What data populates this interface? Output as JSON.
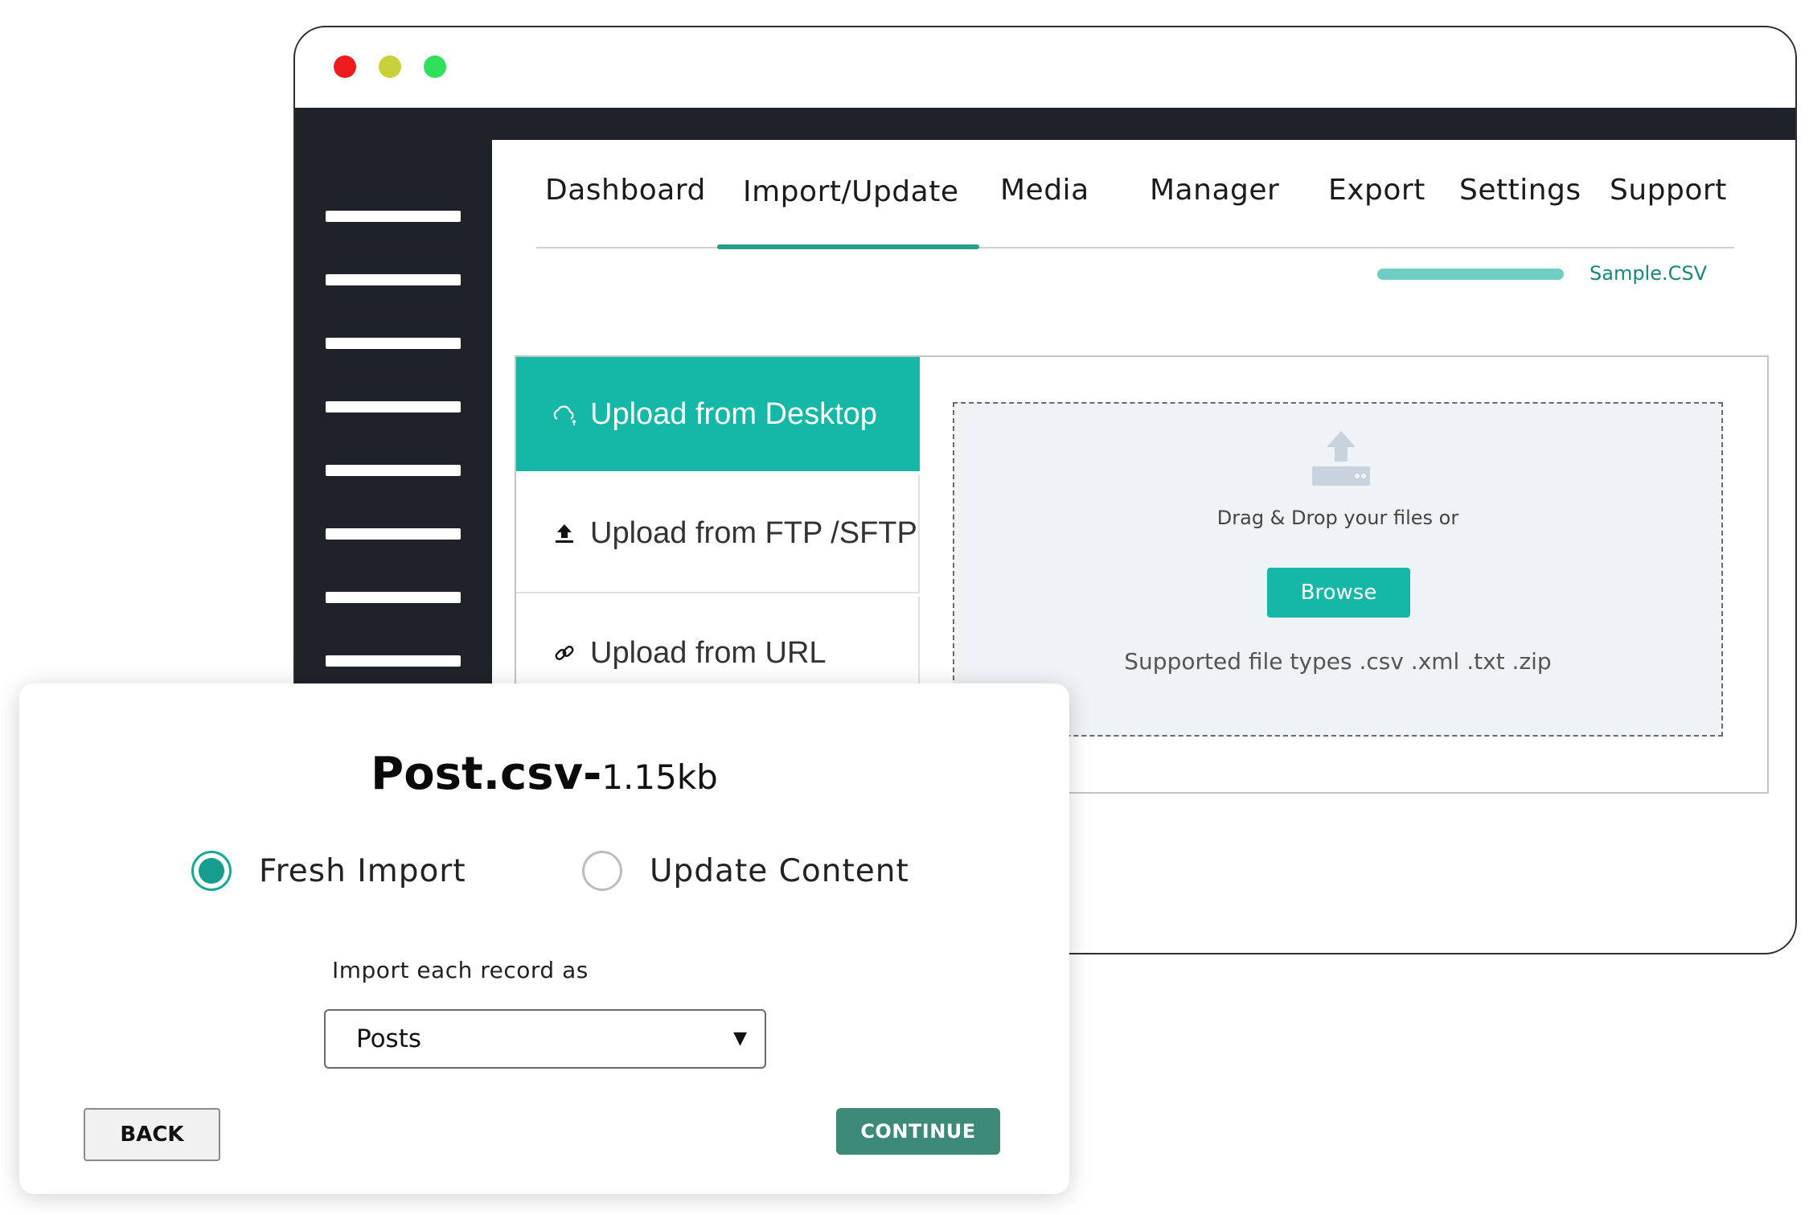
{
  "nav": {
    "tabs": [
      {
        "label": "Dashboard"
      },
      {
        "label": "Import/Update"
      },
      {
        "label": "Media"
      },
      {
        "label": "Manager"
      },
      {
        "label": "Export"
      },
      {
        "label": "Settings"
      },
      {
        "label": "Support"
      }
    ],
    "active_tab": "Import/Update"
  },
  "upload_status": {
    "file_label": "Sample.CSV",
    "progress": 1.0
  },
  "upload_options": {
    "items": [
      {
        "label": "Upload from Desktop",
        "icon": "cloud-upload-icon",
        "active": true
      },
      {
        "label": "Upload from FTP /SFTP",
        "icon": "upload-arrow-icon",
        "active": false
      },
      {
        "label": "Upload from URL",
        "icon": "link-icon",
        "active": false
      }
    ]
  },
  "dropzone": {
    "icon": "upload-tray-icon",
    "text": "Drag & Drop your files or",
    "browse_label": "Browse",
    "supported": "Supported file types .csv .xml .txt .zip"
  },
  "modal": {
    "file_name": "Post.csv-",
    "file_size": "1.15kb",
    "options": [
      {
        "label": "Fresh Import",
        "checked": true
      },
      {
        "label": "Update Content",
        "checked": false
      }
    ],
    "import_label": "Import each record as",
    "select_value": "Posts",
    "back_label": "BACK",
    "continue_label": "CONTINUE"
  },
  "colors": {
    "accent": "#15b8a6",
    "continue": "#3d8a78",
    "sidebar": "#1f2228",
    "window_dots": [
      "#ee1c1c",
      "#c9d13a",
      "#2fe05c"
    ]
  }
}
